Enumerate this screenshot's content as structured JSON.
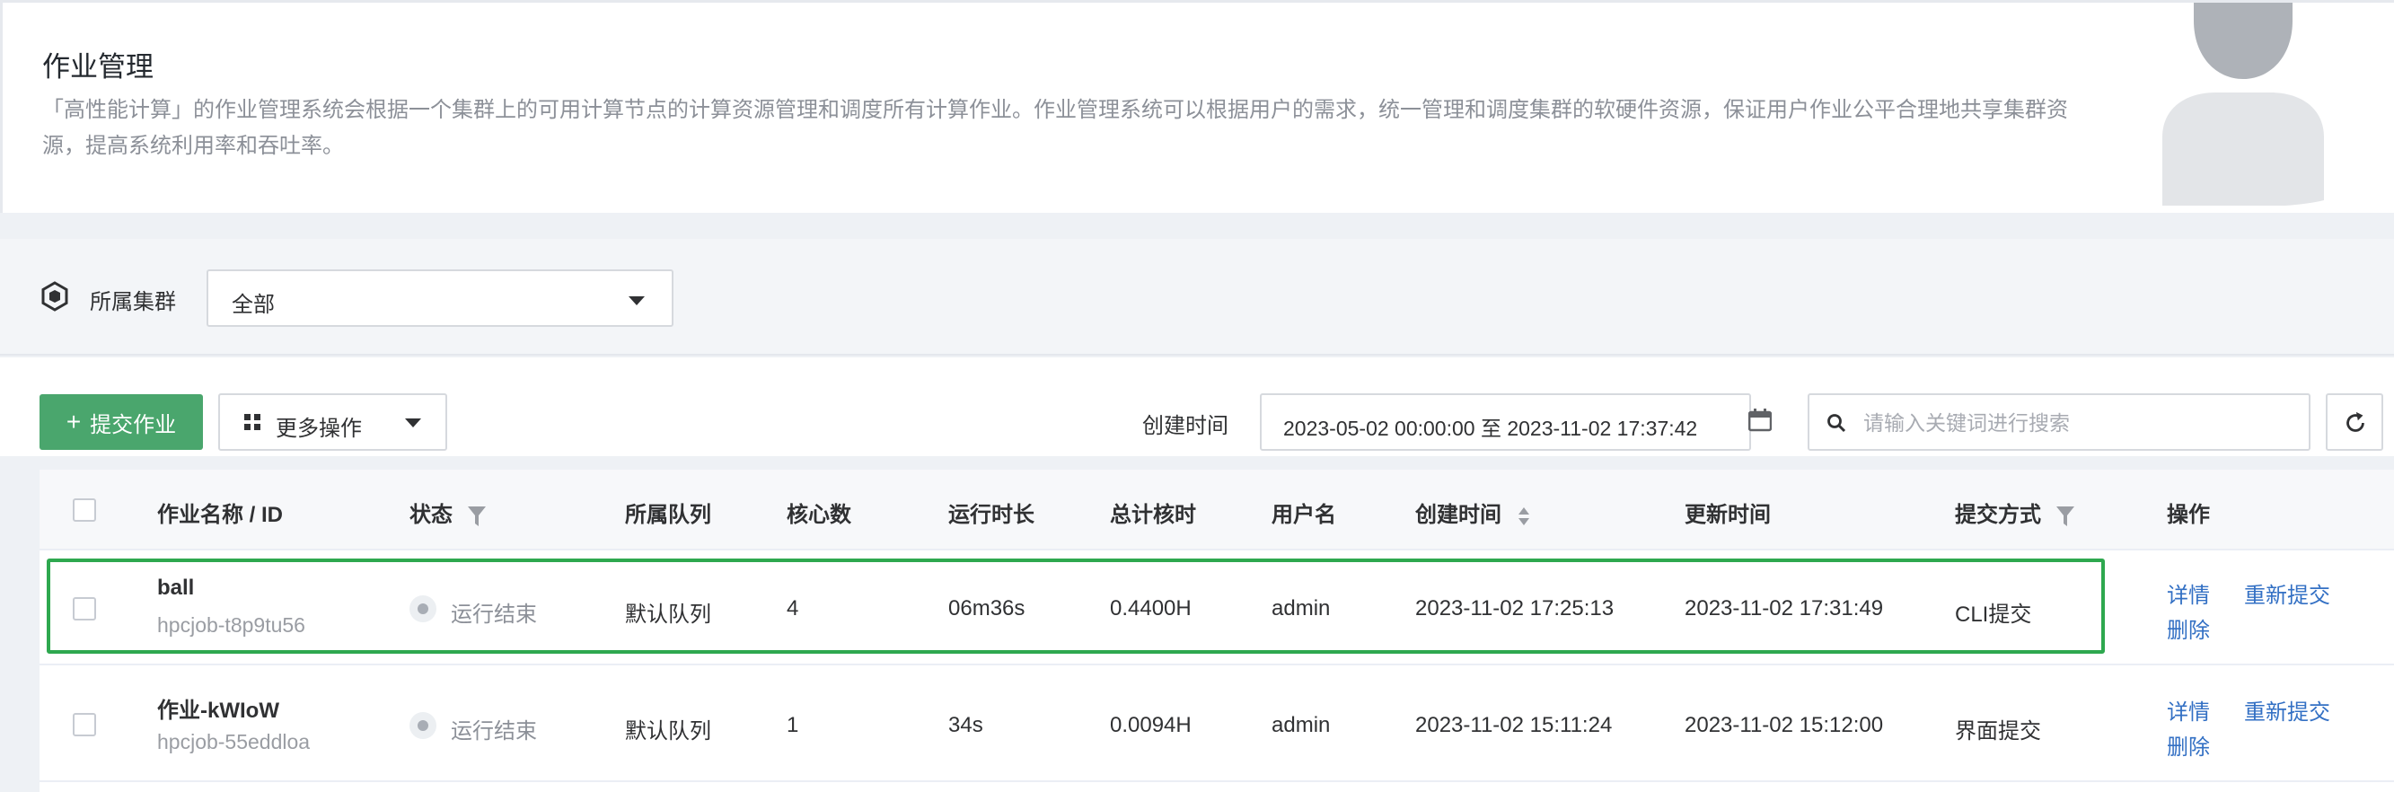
{
  "banner": {
    "title": "作业管理",
    "description": "「高性能计算」的作业管理系统会根据一个集群上的可用计算节点的计算资源管理和调度所有计算作业。作业管理系统可以根据用户的需求，统一管理和调度集群的软硬件资源，保证用户作业公平合理地共享集群资源，提高系统利用率和吞吐率。"
  },
  "filter": {
    "cluster_label": "所属集群",
    "cluster_value": "全部"
  },
  "toolbar": {
    "submit_label": "提交作业",
    "more_label": "更多操作",
    "time_label": "创建时间",
    "date_range": "2023-05-02 00:00:00 至 2023-11-02 17:37:42",
    "search_placeholder": "请输入关键词进行搜索"
  },
  "table": {
    "headers": {
      "name": "作业名称 / ID",
      "status": "状态",
      "queue": "所属队列",
      "cores": "核心数",
      "duration": "运行时长",
      "core_hours": "总计核时",
      "user": "用户名",
      "created": "创建时间",
      "updated": "更新时间",
      "submit_method": "提交方式",
      "actions": "操作"
    },
    "rows": [
      {
        "name": "ball",
        "id": "hpcjob-t8p9tu56",
        "status": "运行结束",
        "queue": "默认队列",
        "cores": "4",
        "duration": "06m36s",
        "core_hours": "0.4400H",
        "user": "admin",
        "created": "2023-11-02 17:25:13",
        "updated": "2023-11-02 17:31:49",
        "submit_method": "CLI提交",
        "action_detail": "详情",
        "action_resubmit": "重新提交",
        "action_delete": "删除"
      },
      {
        "name": "作业-kWIoW",
        "id": "hpcjob-55eddloa",
        "status": "运行结束",
        "queue": "默认队列",
        "cores": "1",
        "duration": "34s",
        "core_hours": "0.0094H",
        "user": "admin",
        "created": "2023-11-02 15:11:24",
        "updated": "2023-11-02 15:12:00",
        "submit_method": "界面提交",
        "action_detail": "详情",
        "action_resubmit": "重新提交",
        "action_delete": "删除"
      }
    ]
  },
  "colors": {
    "primary_green": "#4aa66d",
    "highlight_green": "#2ea84f",
    "link_blue": "#3370c4"
  }
}
